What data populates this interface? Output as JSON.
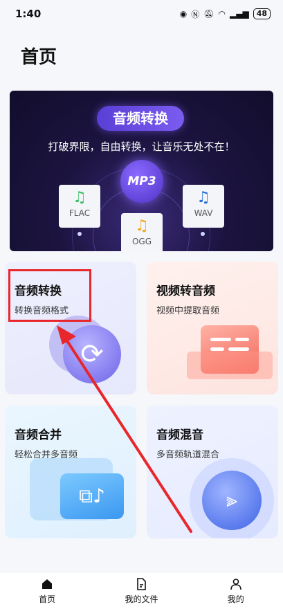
{
  "status_bar": {
    "time": "1:40",
    "battery": "48"
  },
  "page": {
    "title": "首页"
  },
  "banner": {
    "badge": "音频转换",
    "subtitle": "打破界限，自由转换，让音乐无处不在！",
    "center_label": "MP3",
    "formats": [
      "FLAC",
      "WAV",
      "OGG"
    ]
  },
  "cards": [
    {
      "title": "音频转换",
      "subtitle": "转换音频格式"
    },
    {
      "title": "视频转音频",
      "subtitle": "视频中提取音频"
    },
    {
      "title": "音频合并",
      "subtitle": "轻松合并多音频"
    },
    {
      "title": "音频混音",
      "subtitle": "多音频轨道混合"
    }
  ],
  "bottom_nav": [
    {
      "label": "首页"
    },
    {
      "label": "我的文件"
    },
    {
      "label": "我的"
    }
  ],
  "colors": {
    "annotation": "#e8262b",
    "accent": "#6d63e8"
  }
}
